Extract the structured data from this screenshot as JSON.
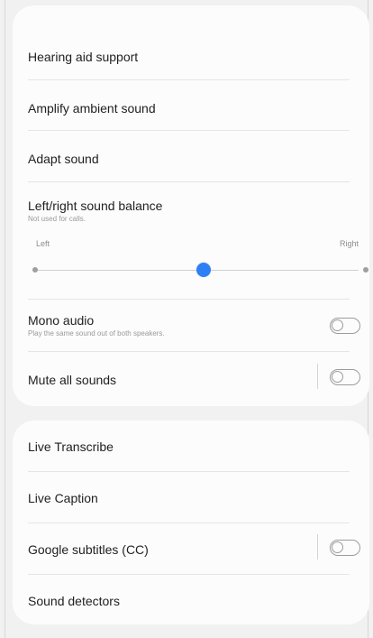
{
  "accessibility_hearing": {
    "items": [
      {
        "label": "Hearing aid support"
      },
      {
        "label": "Amplify ambient sound"
      },
      {
        "label": "Adapt sound"
      },
      {
        "label": "Left/right sound balance",
        "subtitle": "Not used for calls."
      },
      {
        "label": "Mono audio",
        "subtitle": "Play the same sound out of both speakers."
      },
      {
        "label": "Mute all sounds"
      }
    ],
    "balance": {
      "left_label": "Left",
      "right_label": "Right",
      "value": 0.51,
      "accent_color": "#2d7ff6"
    },
    "toggles": {
      "mono_audio": false,
      "mute_all_sounds": false
    }
  },
  "accessibility_captions": {
    "items": [
      {
        "label": "Live Transcribe"
      },
      {
        "label": "Live Caption"
      },
      {
        "label": "Google subtitles (CC)"
      },
      {
        "label": "Sound detectors"
      }
    ],
    "toggles": {
      "google_subtitles": false
    }
  }
}
